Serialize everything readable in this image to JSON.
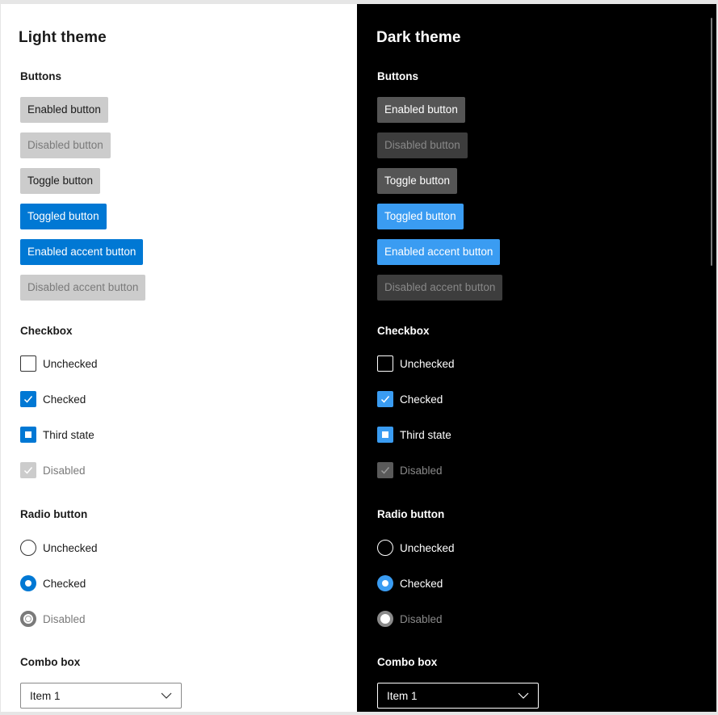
{
  "light": {
    "title": "Light theme",
    "buttons": {
      "heading": "Buttons",
      "enabled": "Enabled button",
      "disabled": "Disabled button",
      "toggle": "Toggle button",
      "toggled": "Toggled button",
      "accent": "Enabled accent button",
      "accent_disabled": "Disabled accent button"
    },
    "checkbox": {
      "heading": "Checkbox",
      "unchecked": "Unchecked",
      "checked": "Checked",
      "third": "Third state",
      "disabled": "Disabled"
    },
    "radio": {
      "heading": "Radio button",
      "unchecked": "Unchecked",
      "checked": "Checked",
      "disabled": "Disabled"
    },
    "combo": {
      "heading": "Combo box",
      "value": "Item 1"
    }
  },
  "dark": {
    "title": "Dark theme",
    "buttons": {
      "heading": "Buttons",
      "enabled": "Enabled button",
      "disabled": "Disabled button",
      "toggle": "Toggle button",
      "toggled": "Toggled button",
      "accent": "Enabled accent button",
      "accent_disabled": "Disabled accent button"
    },
    "checkbox": {
      "heading": "Checkbox",
      "unchecked": "Unchecked",
      "checked": "Checked",
      "third": "Third state",
      "disabled": "Disabled"
    },
    "radio": {
      "heading": "Radio button",
      "unchecked": "Unchecked",
      "checked": "Checked",
      "disabled": "Disabled"
    },
    "combo": {
      "heading": "Combo box",
      "value": "Item 1"
    }
  },
  "icons": {
    "checkmark": "checkmark-icon",
    "indeterminate": "indeterminate-icon",
    "chevron": "chevron-down-icon"
  },
  "colors": {
    "light_accent": "#0078d4",
    "dark_accent": "#3a9cf2",
    "light_background": "#ffffff",
    "dark_background": "#000000"
  }
}
